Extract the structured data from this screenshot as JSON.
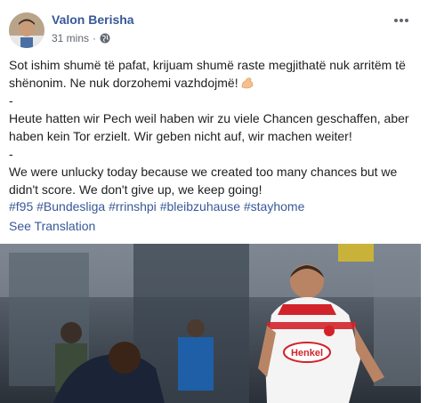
{
  "post": {
    "author": "Valon Berisha",
    "timestamp": "31 mins",
    "privacy_icon": "globe-icon",
    "more_icon": "more-options-icon",
    "text": {
      "albanian": "Sot ishim shumë të pafat, krijuam shumë raste megjithatë nuk arritëm të shënonim. Ne nuk dorzohemi vazhdojmë!",
      "separator_1": "-",
      "german": "Heute hatten wir Pech weil haben wir zu viele Chancen geschaffen, aber haben kein Tor erzielt. Wir geben nicht auf, wir machen weiter!",
      "separator_2": "-",
      "english": "We were unlucky today because we created too many chances but we didn't score. We don't give up, we keep going!"
    },
    "emoji": "flexed-biceps-emoji",
    "hashtags": [
      "#f95",
      "#Bundesliga",
      "#rrinshpi",
      "#bleibzuhause",
      "#stayhome"
    ],
    "see_translation": "See Translation",
    "photo": {
      "shirt_sponsor": "Henkel"
    }
  },
  "colors": {
    "link": "#385898",
    "meta": "#616770",
    "text": "#1c1e21",
    "jersey_red": "#d2232a"
  }
}
